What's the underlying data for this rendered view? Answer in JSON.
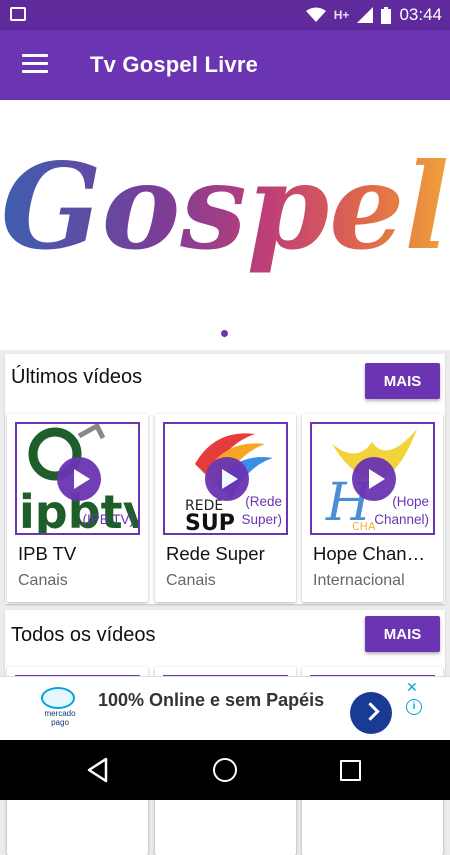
{
  "status_bar": {
    "network": "H+",
    "time": "03:44"
  },
  "app_bar": {
    "title": "Tv Gospel Livre"
  },
  "banner": {
    "text": "Gospel"
  },
  "sections": [
    {
      "title": "Últimos vídeos",
      "more_label": "MAIS",
      "cards": [
        {
          "title": "IPB TV",
          "category": "Canais",
          "thumb_caption": "(IPB TV)",
          "logo_text": "ipbtv"
        },
        {
          "title": "Rede Super",
          "category": "Canais",
          "thumb_caption": "(Rede Super)",
          "logo_text_1": "REDE",
          "logo_text_2": "SUP"
        },
        {
          "title": "Hope Chan…",
          "category": "Internacional",
          "thumb_caption": "(Hope Channel)",
          "logo_text": "CHA"
        }
      ]
    },
    {
      "title": "Todos os vídeos",
      "more_label": "MAIS"
    }
  ],
  "ad": {
    "brand_line1": "mercado",
    "brand_line2": "pago",
    "text": "100% Online e sem Papéis"
  },
  "colors": {
    "primary": "#6a34b3",
    "status": "#5e2a9c"
  }
}
